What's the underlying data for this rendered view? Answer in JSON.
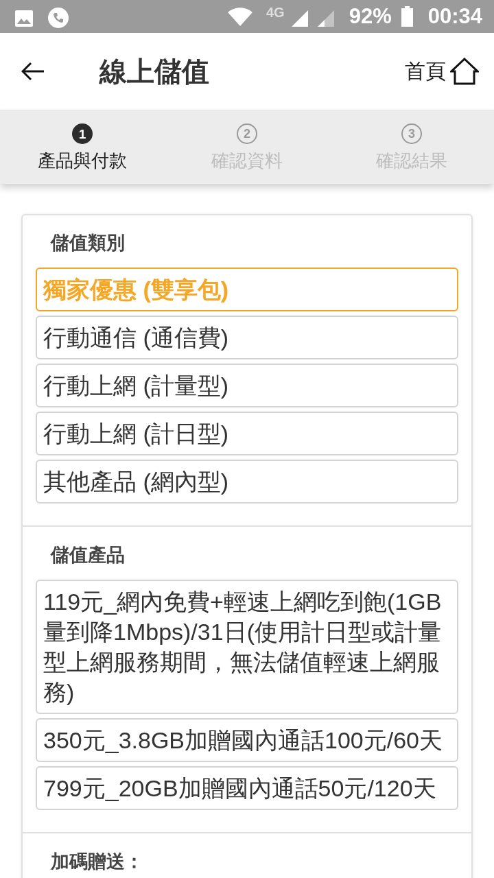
{
  "status_bar": {
    "network": "4G",
    "battery": "92%",
    "time": "00:34"
  },
  "header": {
    "title": "線上儲值",
    "home_link": "首頁"
  },
  "steps": [
    {
      "number": "1",
      "label": "產品與付款",
      "selected": true
    },
    {
      "number": "2",
      "label": "確認資料",
      "selected": false
    },
    {
      "number": "3",
      "label": "確認結果",
      "selected": false
    }
  ],
  "sections": [
    {
      "heading": "儲值類別",
      "options": [
        {
          "label": "獨家優惠 (雙享包)",
          "selected": true
        },
        {
          "label": "行動通信 (通信費)",
          "selected": false
        },
        {
          "label": "行動上網 (計量型)",
          "selected": false
        },
        {
          "label": "行動上網 (計日型)",
          "selected": false
        },
        {
          "label": "其他產品 (網內型)",
          "selected": false
        }
      ]
    },
    {
      "heading": "儲值產品",
      "options": [
        {
          "label": "119元_網內免費+輕速上網吃到飽(1GB量到降1Mbps)/31日(使用計日型或計量型上網服務期間，無法儲值輕速上網服務)",
          "selected": false
        },
        {
          "label": "350元_3.8GB加贈國內通話100元/60天",
          "selected": false
        },
        {
          "label": "799元_20GB加贈國內通話50元/120天",
          "selected": false
        }
      ]
    },
    {
      "heading": "加碼贈送："
    }
  ]
}
